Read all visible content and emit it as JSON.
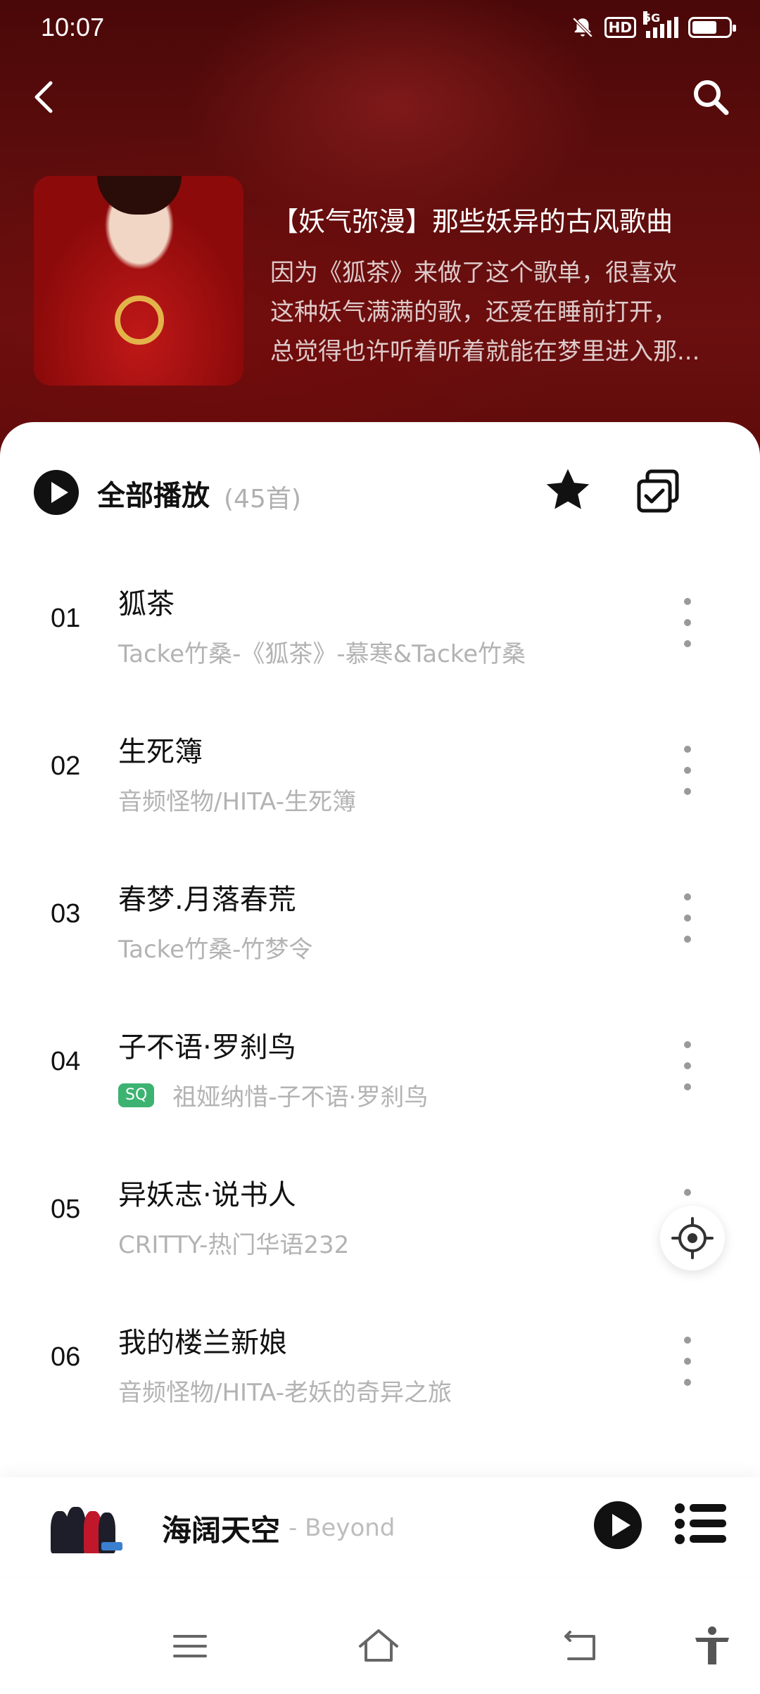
{
  "status_bar": {
    "time": "10:07",
    "icons": [
      "mute-bell-icon",
      "hd-icon",
      "5g-signal-icon",
      "battery-icon"
    ],
    "hd_label": "HD",
    "network_label": "5G"
  },
  "header": {
    "back_icon": "chevron-left-icon",
    "search_icon": "search-icon"
  },
  "playlist": {
    "title": "【妖气弥漫】那些妖异的古风歌曲",
    "description_lines": [
      "因为《狐茶》来做了这个歌单，很喜欢",
      "这种妖气满满的歌，还爱在睡前打开，",
      "总觉得也许听着听着就能在梦里进入那..."
    ]
  },
  "toolbar": {
    "play_all_label": "全部播放",
    "count": "(45首)",
    "star_icon": "star-icon",
    "multi_select_icon": "multi-select-icon"
  },
  "songs": [
    {
      "index": "01",
      "title": "狐茶",
      "subtitle": "Tacke竹桑-《狐茶》-慕寒&Tacke竹桑",
      "badge": ""
    },
    {
      "index": "02",
      "title": "生死簿",
      "subtitle": "音频怪物/HITA-生死簿",
      "badge": ""
    },
    {
      "index": "03",
      "title": "春梦.月落春荒",
      "subtitle": "Tacke竹桑-竹梦令",
      "badge": ""
    },
    {
      "index": "04",
      "title": "子不语·罗刹鸟",
      "subtitle": "祖娅纳惜-子不语·罗刹鸟",
      "badge": "SQ"
    },
    {
      "index": "05",
      "title": "异妖志·说书人",
      "subtitle": "CRITTY-热门华语232",
      "badge": ""
    },
    {
      "index": "06",
      "title": "我的楼兰新娘",
      "subtitle": "音频怪物/HITA-老妖的奇异之旅",
      "badge": ""
    }
  ],
  "mini_player": {
    "title": "海阔天空",
    "artist": "- Beyond",
    "play_icon": "play-icon",
    "playlist_icon": "playlist-icon"
  },
  "nav_bar": {
    "icons": [
      "menu-icon",
      "home-icon",
      "back-icon",
      "accessibility-icon"
    ]
  },
  "colors": {
    "header_bg": "#5a0c0c",
    "badge_green": "#3cb371",
    "muted_text": "#b3b3b3"
  }
}
